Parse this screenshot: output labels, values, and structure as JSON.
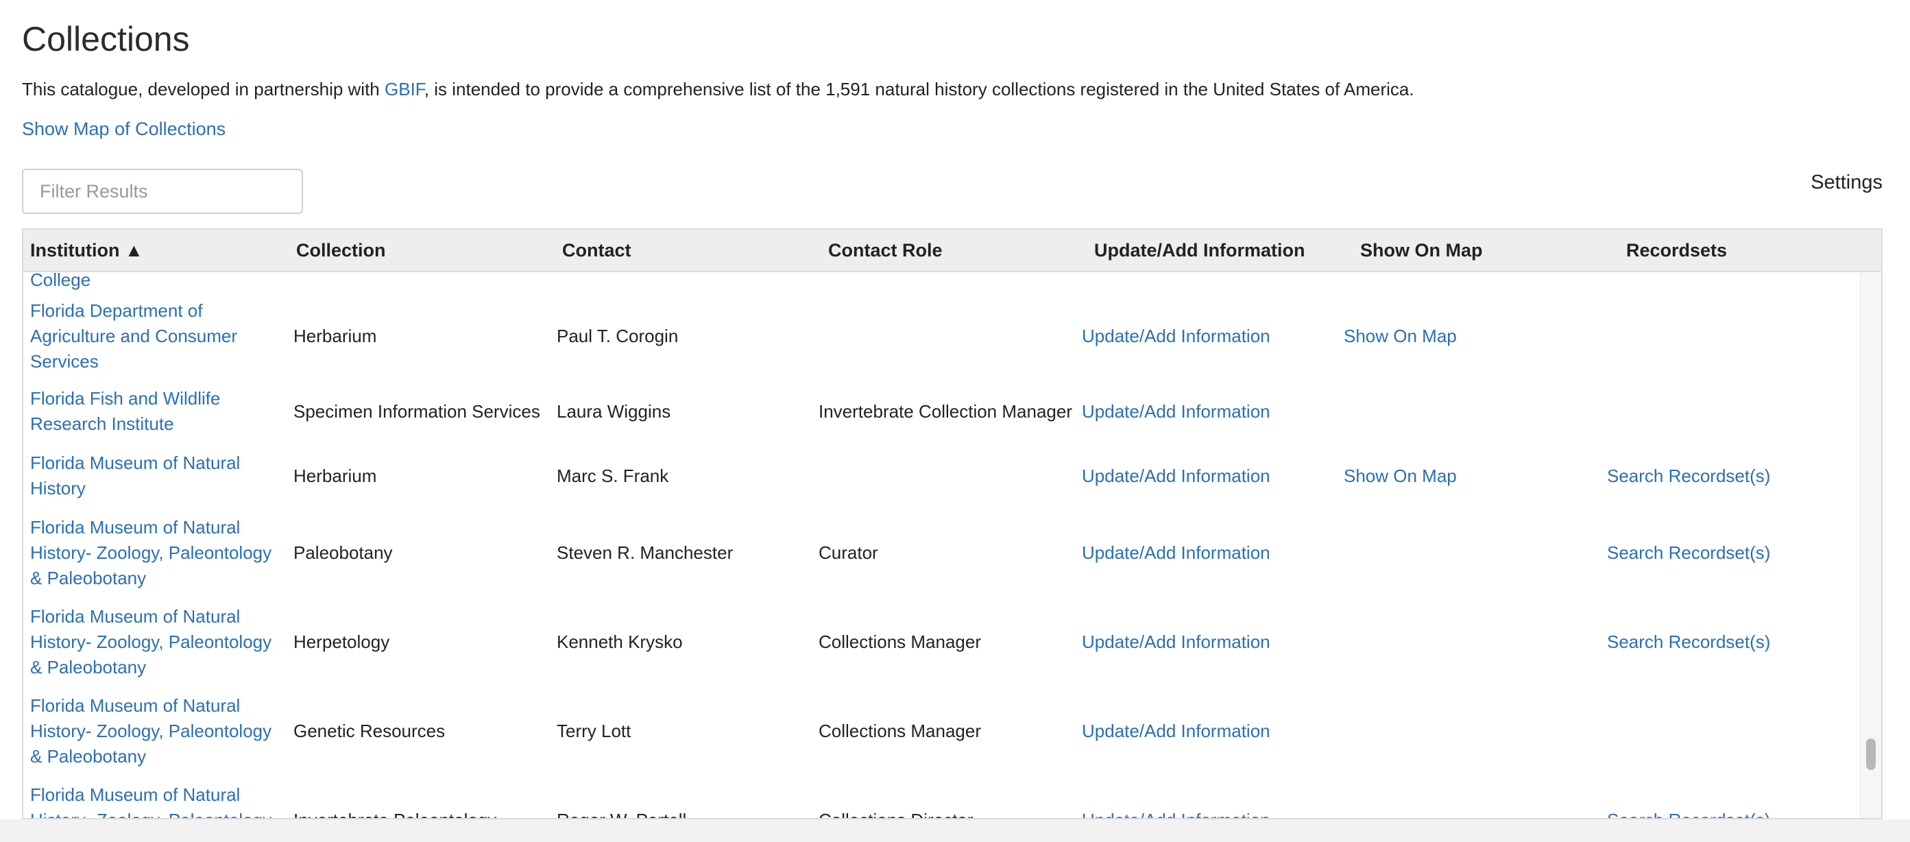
{
  "header": {
    "title": "Collections",
    "intro_before": "This catalogue, developed in partnership with ",
    "intro_link": "GBIF",
    "intro_after": ", is intended to provide a comprehensive list of the 1,591 natural history collections registered in the United States of America.",
    "map_link": "Show Map of Collections"
  },
  "filter": {
    "placeholder": "Filter Results",
    "value": ""
  },
  "settings_label": "Settings",
  "colors": {
    "link": "#2a6fb5",
    "header_bg": "#eeeeee",
    "text": "#222222"
  },
  "table": {
    "columns": [
      "Institution ▲",
      "Collection",
      "Contact",
      "Contact Role",
      "Update/Add Information",
      "Show On Map",
      "Recordsets"
    ],
    "rows": [
      {
        "institution": "College",
        "collection": "",
        "contact": "",
        "role": "",
        "update": "",
        "map": "",
        "recordsets": ""
      },
      {
        "institution": "Florida Department of Agriculture and Consumer Services",
        "collection": "Herbarium",
        "contact": "Paul T. Corogin",
        "role": "",
        "update": "Update/Add Information",
        "map": "Show On Map",
        "recordsets": ""
      },
      {
        "institution": "Florida Fish and Wildlife Research Institute",
        "collection": "Specimen Information Services",
        "contact": "Laura Wiggins",
        "role": "Invertebrate Collection Manager",
        "update": "Update/Add Information",
        "map": "",
        "recordsets": ""
      },
      {
        "institution": "Florida Museum of Natural History",
        "collection": "Herbarium",
        "contact": "Marc S. Frank",
        "role": "",
        "update": "Update/Add Information",
        "map": "Show On Map",
        "recordsets": "Search Recordset(s)"
      },
      {
        "institution": "Florida Museum of Natural History- Zoology, Paleontology & Paleobotany",
        "collection": "Paleobotany",
        "contact": "Steven R. Manchester",
        "role": "Curator",
        "update": "Update/Add Information",
        "map": "",
        "recordsets": "Search Recordset(s)"
      },
      {
        "institution": "Florida Museum of Natural History- Zoology, Paleontology & Paleobotany",
        "collection": "Herpetology",
        "contact": "Kenneth Krysko",
        "role": "Collections Manager",
        "update": "Update/Add Information",
        "map": "",
        "recordsets": "Search Recordset(s)"
      },
      {
        "institution": "Florida Museum of Natural History- Zoology, Paleontology & Paleobotany",
        "collection": "Genetic Resources",
        "contact": "Terry Lott",
        "role": "Collections Manager",
        "update": "Update/Add Information",
        "map": "",
        "recordsets": ""
      },
      {
        "institution": "Florida Museum of Natural History- Zoology, Paleontology & Paleobotany",
        "collection": "Invertebrate Paleontology",
        "contact": "Roger W. Portell",
        "role": "Collections Director",
        "update": "Update/Add Information",
        "map": "",
        "recordsets": "Search Recordset(s)"
      }
    ]
  }
}
